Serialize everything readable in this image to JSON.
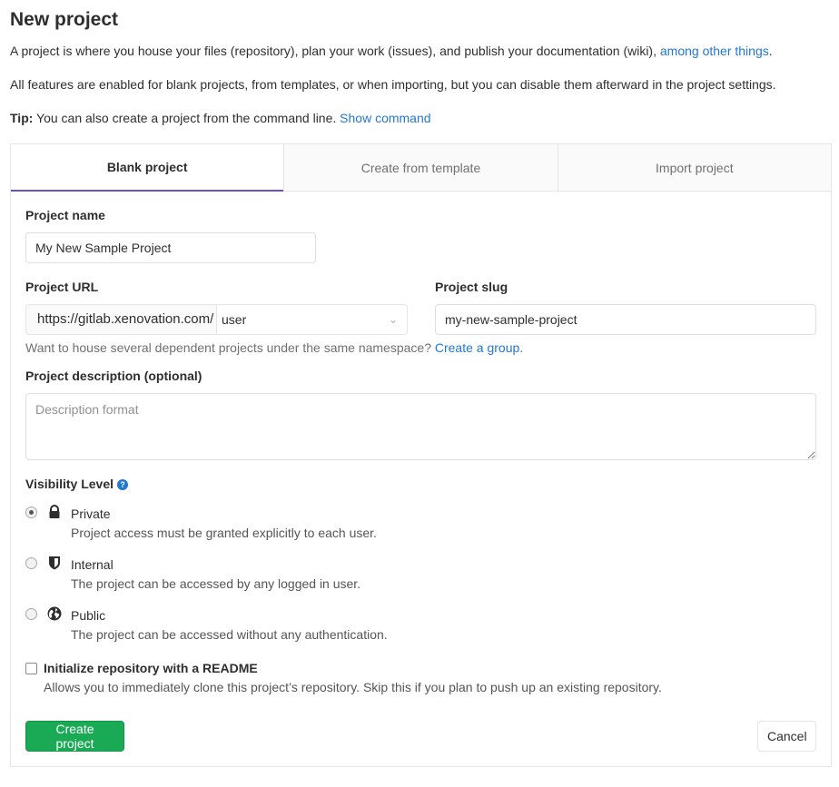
{
  "header": {
    "title": "New project",
    "intro_text": "A project is where you house your files (repository), plan your work (issues), and publish your documentation (wiki),",
    "intro_link": "among other things",
    "intro_end": ".",
    "features_text": "All features are enabled for blank projects, from templates, or when importing, but you can disable them afterward in the project settings.",
    "tip_label": "Tip:",
    "tip_text": "You can also create a project from the command line.",
    "tip_link": "Show command"
  },
  "tabs": [
    {
      "label": "Blank project",
      "active": true
    },
    {
      "label": "Create from template",
      "active": false
    },
    {
      "label": "Import project",
      "active": false
    }
  ],
  "form": {
    "project_name_label": "Project name",
    "project_name_value": "My New Sample Project",
    "project_url_label": "Project URL",
    "url_prefix": "https://gitlab.xenovation.com/",
    "namespace_value": "user",
    "project_slug_label": "Project slug",
    "project_slug_value": "my-new-sample-project",
    "namespace_help": "Want to house several dependent projects under the same namespace?",
    "namespace_help_link": "Create a group.",
    "description_label": "Project description (optional)",
    "description_placeholder": "Description format",
    "visibility_label": "Visibility Level",
    "visibility_help_icon": "question-circle-icon",
    "visibility_options": [
      {
        "title": "Private",
        "desc": "Project access must be granted explicitly to each user.",
        "icon": "lock-icon",
        "checked": true
      },
      {
        "title": "Internal",
        "desc": "The project can be accessed by any logged in user.",
        "icon": "shield-icon",
        "checked": false
      },
      {
        "title": "Public",
        "desc": "The project can be accessed without any authentication.",
        "icon": "globe-icon",
        "checked": false
      }
    ],
    "readme_label": "Initialize repository with a README",
    "readme_desc": "Allows you to immediately clone this project’s repository. Skip this if you plan to push up an existing repository.",
    "readme_checked": false
  },
  "actions": {
    "create_label": "Create project",
    "cancel_label": "Cancel"
  },
  "colors": {
    "link": "#1f78d1",
    "primary_button": "#1aaa55",
    "active_tab_border": "#6b4fbb"
  }
}
